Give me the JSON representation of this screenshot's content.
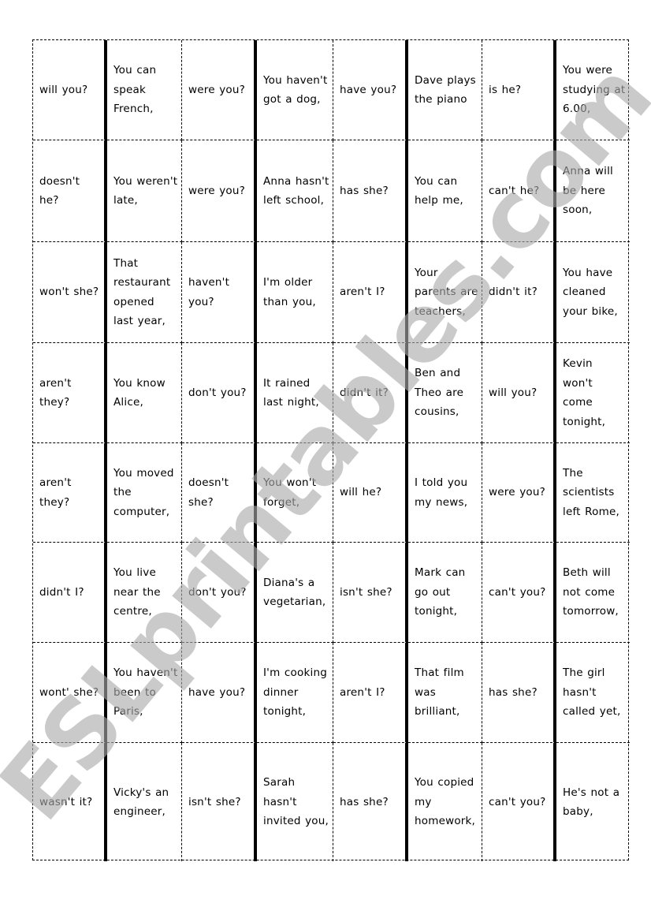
{
  "worksheet": {
    "watermark": "ESLprintables.com",
    "rows": [
      [
        "will you?",
        "You can speak French,",
        "were you?",
        "You haven't got a dog,",
        "have you?",
        "Dave plays the piano",
        "is he?",
        "You were studying at 6.00,"
      ],
      [
        "doesn't he?",
        "You weren't late,",
        "were you?",
        "Anna hasn't left school,",
        "has she?",
        "You can help me,",
        "can't he?",
        "Anna will be here soon,"
      ],
      [
        "won't she?",
        "That restaurant opened last year,",
        "haven't you?",
        "I'm older than you,",
        "aren't I?",
        "Your parents are teachers,",
        "didn't it?",
        "You have cleaned your bike,"
      ],
      [
        "aren't they?",
        "You know Alice,",
        "don't you?",
        "It rained last night,",
        "didn't it?",
        "Ben and Theo are cousins,",
        "will you?",
        "Kevin won't come tonight,"
      ],
      [
        "aren't they?",
        "You moved the computer,",
        "doesn't she?",
        "You won't forget,",
        "will he?",
        "I told you my news,",
        "were you?",
        "The scientists left Rome,"
      ],
      [
        "didn't I?",
        "You live near the centre,",
        "don't you?",
        "Diana's a vegetarian,",
        "isn't she?",
        "Mark can go out tonight,",
        "can't you?",
        "Beth will not come tomorrow,"
      ],
      [
        "wont' she?",
        "You haven't been to Paris,",
        "have you?",
        "I'm cooking dinner tonight,",
        "aren't I?",
        "That film was brilliant,",
        "has she?",
        "The girl hasn't called yet,"
      ],
      [
        "wasn't it?",
        "Vicky's an engineer,",
        "isn't she?",
        "Sarah hasn't invited you,",
        "has she?",
        "You copied my homework,",
        "can't you?",
        "He's not a baby,"
      ]
    ]
  }
}
